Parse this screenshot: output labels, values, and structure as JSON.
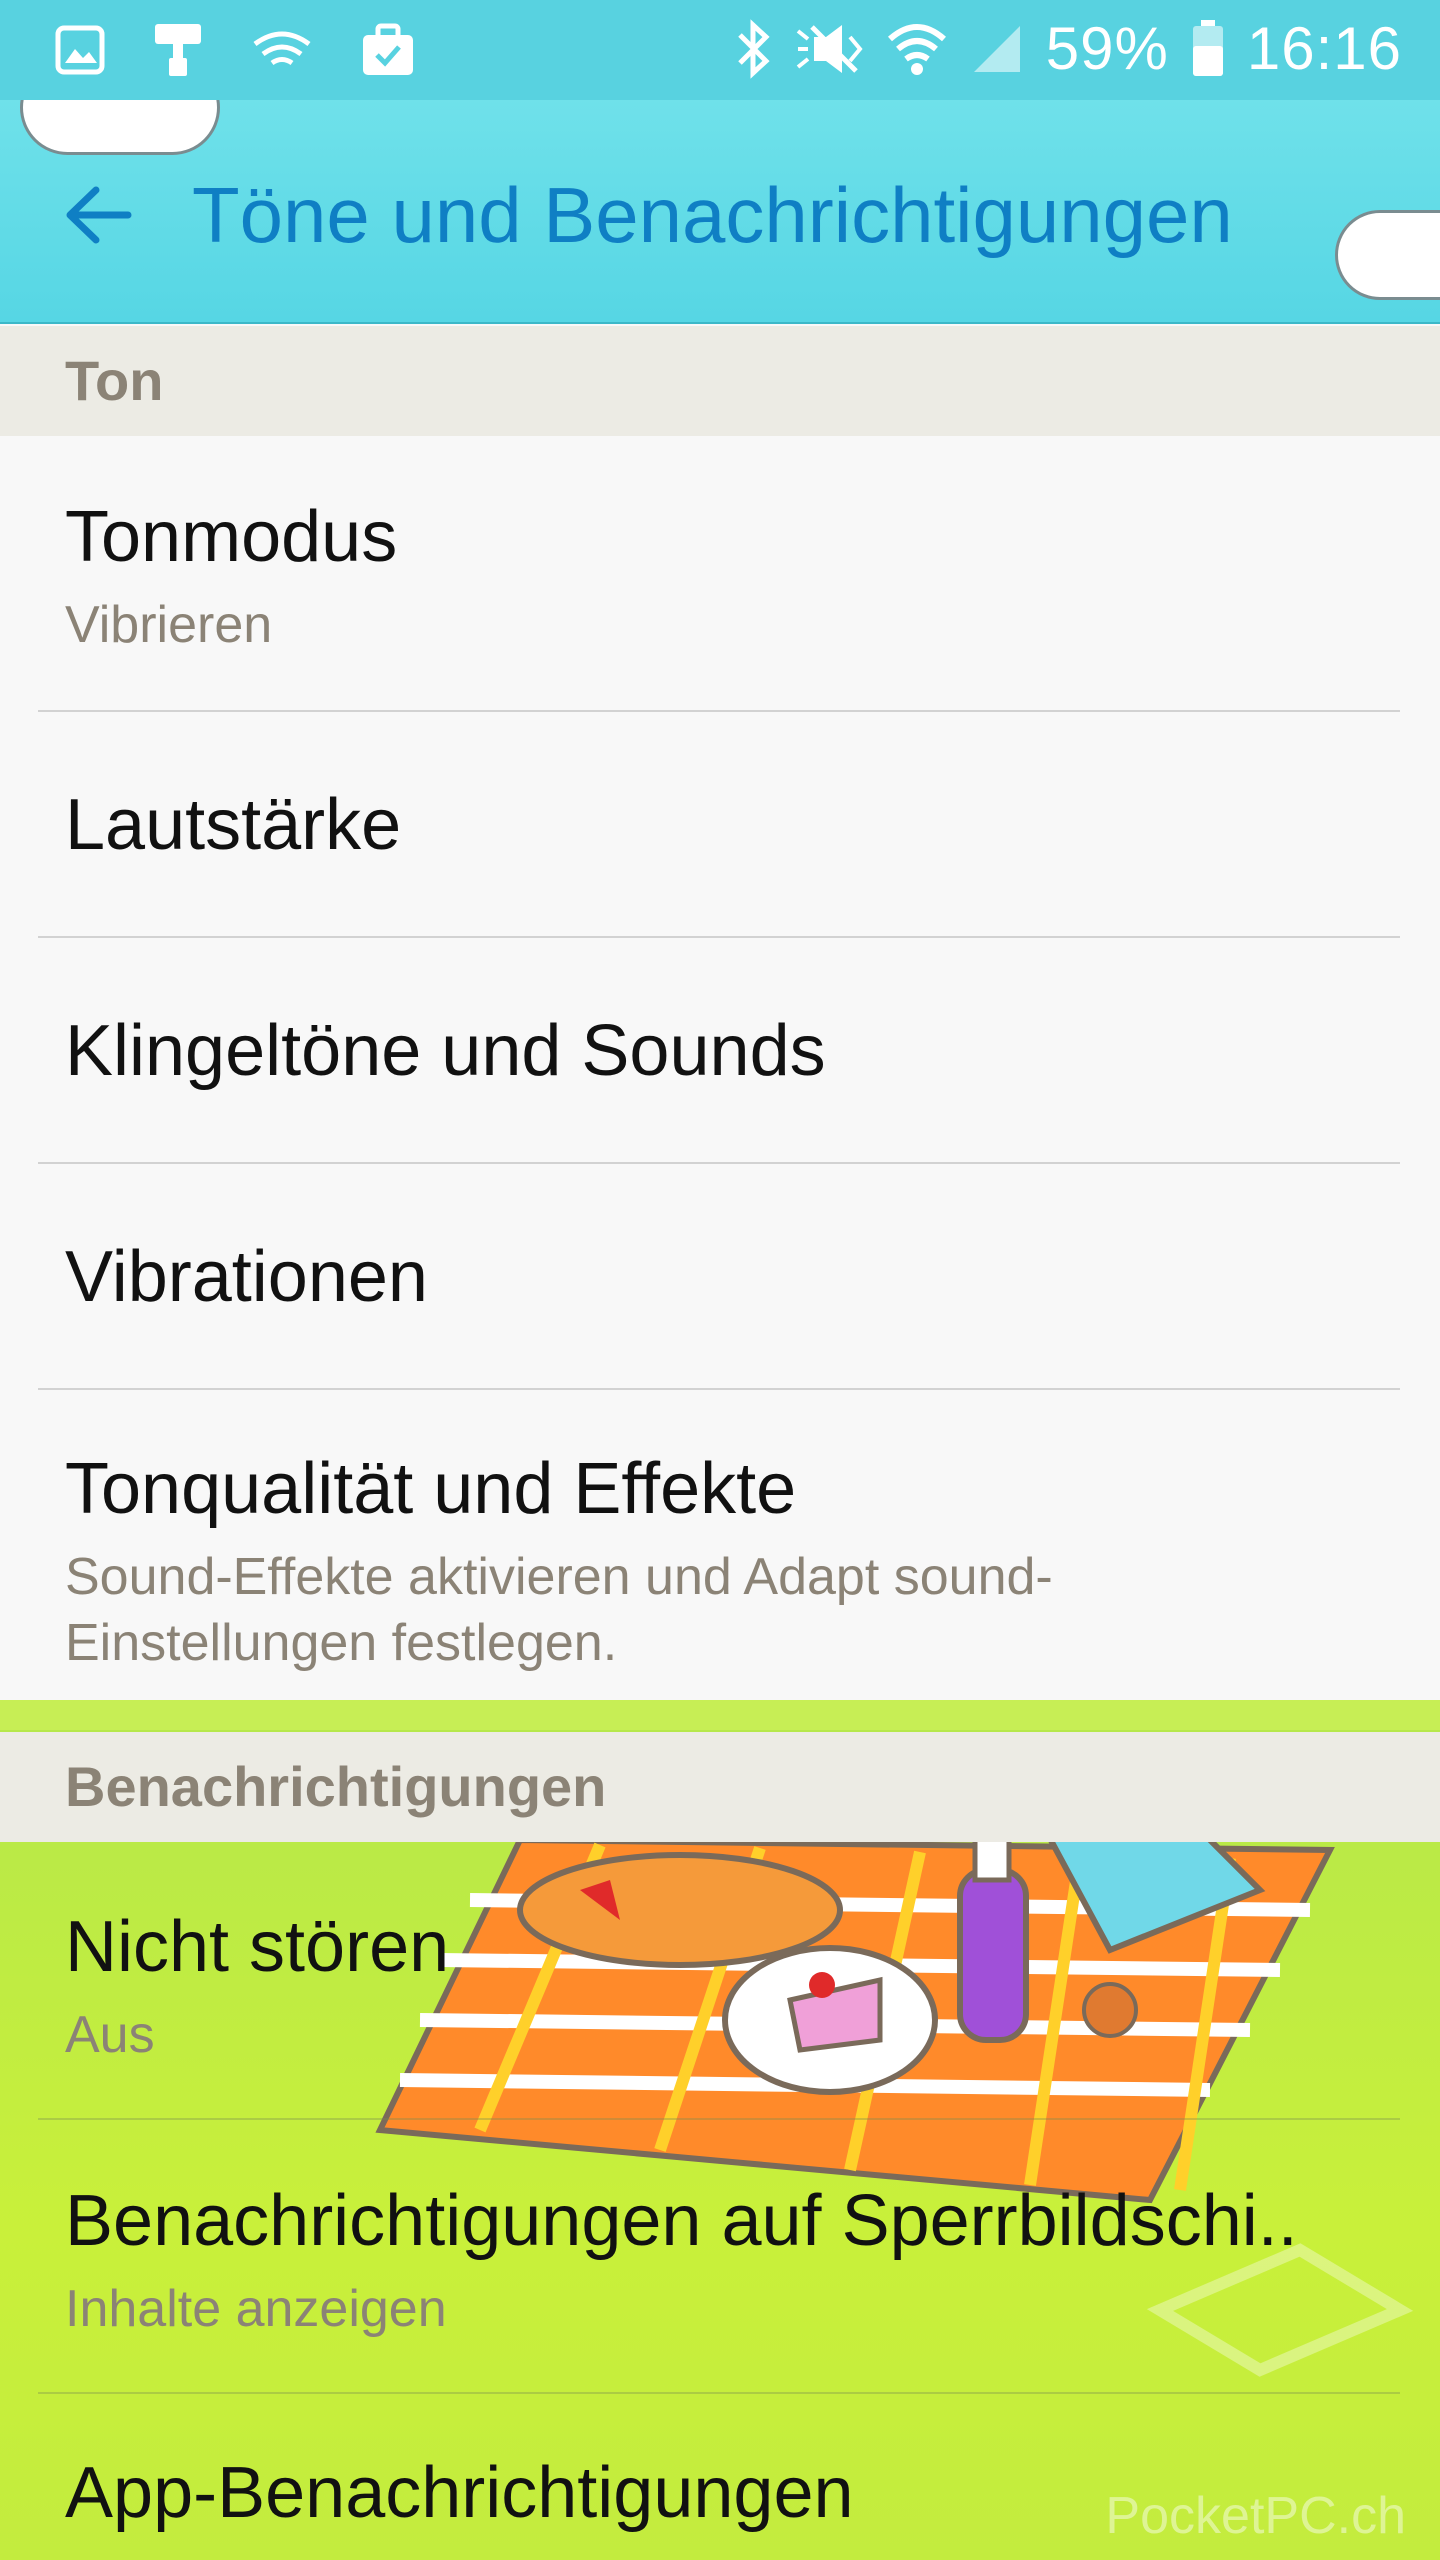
{
  "status_bar": {
    "battery": "59%",
    "time": "16:16",
    "icons": [
      "gallery-icon",
      "paint-roller-icon",
      "wifi-calling-icon",
      "briefcase-icon",
      "bluetooth-icon",
      "mute-icon",
      "wifi-icon",
      "signal-icon",
      "battery-icon"
    ]
  },
  "header": {
    "title": "Töne und Benachrichtigungen",
    "back_icon": "arrow-left-icon",
    "accent": "#0f7fc4"
  },
  "sections": {
    "ton": {
      "label": "Ton"
    },
    "notifications": {
      "label": "Benachrichtigungen"
    }
  },
  "items": {
    "tonmodus": {
      "title": "Tonmodus",
      "subtitle": "Vibrieren"
    },
    "lautstaerke": {
      "title": "Lautstärke"
    },
    "klingeltoene": {
      "title": "Klingeltöne und Sounds"
    },
    "vibrationen": {
      "title": "Vibrationen"
    },
    "tonqualitaet": {
      "title": "Tonqualität und Effekte",
      "subtitle_line1": "Sound-Effekte aktivieren und Adapt sound-",
      "subtitle_line2": "Einstellungen festlegen."
    },
    "nicht_stoeren": {
      "title": "Nicht stören",
      "subtitle": "Aus"
    },
    "sperrbildschirm": {
      "title": "Benachrichtigungen auf Sperrbildschi..",
      "subtitle": "Inhalte anzeigen"
    },
    "app_benachrichtigungen": {
      "title": "App-Benachrichtigungen"
    }
  },
  "watermark": "PocketPC.ch",
  "colors": {
    "status_bar": "#58d2e0",
    "section_header_bg": "#ecebe4",
    "subtitle": "#8b8376",
    "grass": "#c2ec3c"
  }
}
